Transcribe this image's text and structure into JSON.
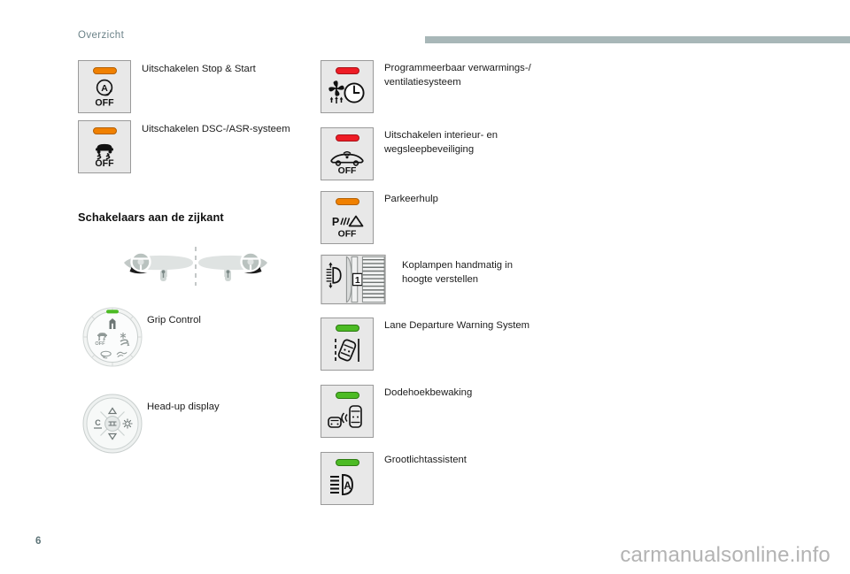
{
  "header": {
    "section_title": "Overzicht"
  },
  "left_column": {
    "buttons": [
      {
        "name": "stop-start-off",
        "led_color": "#f08000",
        "led_name": "orange",
        "icon": "auto-stop-start-off-icon",
        "sub_label": "OFF",
        "caption": "Uitschakelen Stop & Start"
      },
      {
        "name": "dsc-asr-off",
        "led_color": "#f08000",
        "led_name": "orange",
        "icon": "traction-control-off-icon",
        "sub_label": "OFF",
        "caption": "Uitschakelen DSC-/ASR-systeem"
      }
    ],
    "section_heading": "Schakelaars aan de zijkant",
    "dashboard_diagram": {
      "name": "lhd-rhd-dashboard-diagram",
      "left_variant": "left-hand-drive",
      "right_variant": "right-hand-drive"
    },
    "knobs": [
      {
        "name": "grip-control-knob",
        "icon": "grip-control-rotary-icon",
        "led_color": "#4cbb24",
        "caption": "Grip Control"
      },
      {
        "name": "head-up-display-control",
        "icon": "head-up-display-pad-icon",
        "caption": "Head-up display"
      }
    ]
  },
  "right_column": {
    "buttons": [
      {
        "name": "programmable-heating-ventilation",
        "led_color": "#ee1c25",
        "led_name": "red",
        "icon": "fan-clock-icon",
        "sub_label": "",
        "caption": "Programmeerbaar verwarmings-/\nventilatiesysteem"
      },
      {
        "name": "interior-tow-away-protection-off",
        "led_color": "#ee1c25",
        "led_name": "red",
        "icon": "car-alarm-off-icon",
        "sub_label": "OFF",
        "caption": "Uitschakelen interieur- en\nwegsleepbeveiliging"
      },
      {
        "name": "park-assist-off",
        "led_color": "#f08000",
        "led_name": "orange",
        "icon": "park-sensor-off-icon",
        "sub_label": "OFF",
        "caption": "Parkeerhulp"
      },
      {
        "name": "headlight-height-adjust",
        "led_color": "",
        "led_name": "none",
        "icon": "headlight-leveling-wheel-icon",
        "sub_label": "1",
        "caption": "Koplampen handmatig in\nhoogte verstellen"
      },
      {
        "name": "lane-departure-warning",
        "led_color": "#4cbb24",
        "led_name": "green",
        "icon": "lane-departure-icon",
        "sub_label": "",
        "caption": "Lane Departure Warning System"
      },
      {
        "name": "blind-spot-monitoring",
        "led_color": "#4cbb24",
        "led_name": "green",
        "icon": "blind-spot-icon",
        "sub_label": "",
        "caption": "Dodehoekbewaking"
      },
      {
        "name": "high-beam-assist",
        "led_color": "#4cbb24",
        "led_name": "green",
        "icon": "high-beam-auto-icon",
        "sub_label": "",
        "caption": "Grootlichtassistent"
      }
    ]
  },
  "footer": {
    "page_number": "6",
    "watermark": "carmanualsonline.info"
  },
  "colors": {
    "rule": "#a8b7b8",
    "header_text": "#6b8288",
    "button_face": "#e8e8e8",
    "button_border": "#9a9a9a"
  }
}
